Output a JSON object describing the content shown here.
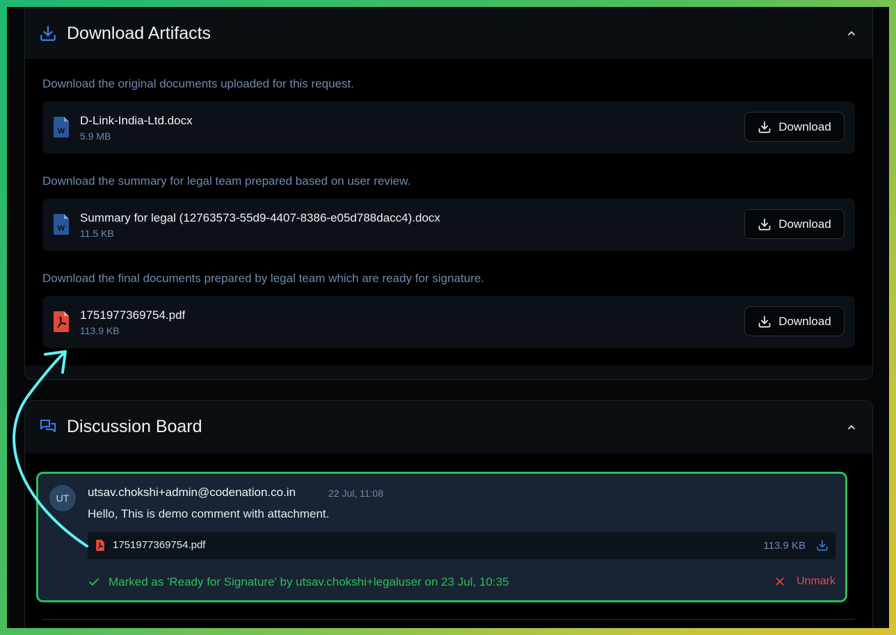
{
  "artifacts": {
    "title": "Download Artifacts",
    "sections": [
      {
        "description": "Download the original documents uploaded for this request.",
        "file": {
          "name": "D-Link-India-Ltd.docx",
          "size": "5.9 MB",
          "type": "word"
        },
        "button": "Download"
      },
      {
        "description": "Download the summary for legal team prepared based on user review.",
        "file": {
          "name": "Summary for legal (12763573-55d9-4407-8386-e05d788dacc4).docx",
          "size": "11.5 KB",
          "type": "word"
        },
        "button": "Download"
      },
      {
        "description": "Download the final documents prepared by legal team which are ready for signature.",
        "file": {
          "name": "1751977369754.pdf",
          "size": "113.9 KB",
          "type": "pdf"
        },
        "button": "Download"
      }
    ]
  },
  "discussion": {
    "title": "Discussion Board",
    "comment": {
      "avatar_initials": "UT",
      "author": "utsav.chokshi+admin@codenation.co.in",
      "time": "22 Jul, 11:08",
      "text": "Hello, This is demo comment with attachment.",
      "attachment": {
        "name": "1751977369754.pdf",
        "size": "113.9 KB"
      },
      "marked_text": "Marked as 'Ready for Signature' by utsav.chokshi+legaluser on 23 Jul, 10:35",
      "unmark_label": "Unmark"
    }
  },
  "colors": {
    "accent_blue": "#3b82f6",
    "success_green": "#2fbe58",
    "danger_red": "#e5484d",
    "annotation_cyan": "#5ef2f4"
  }
}
